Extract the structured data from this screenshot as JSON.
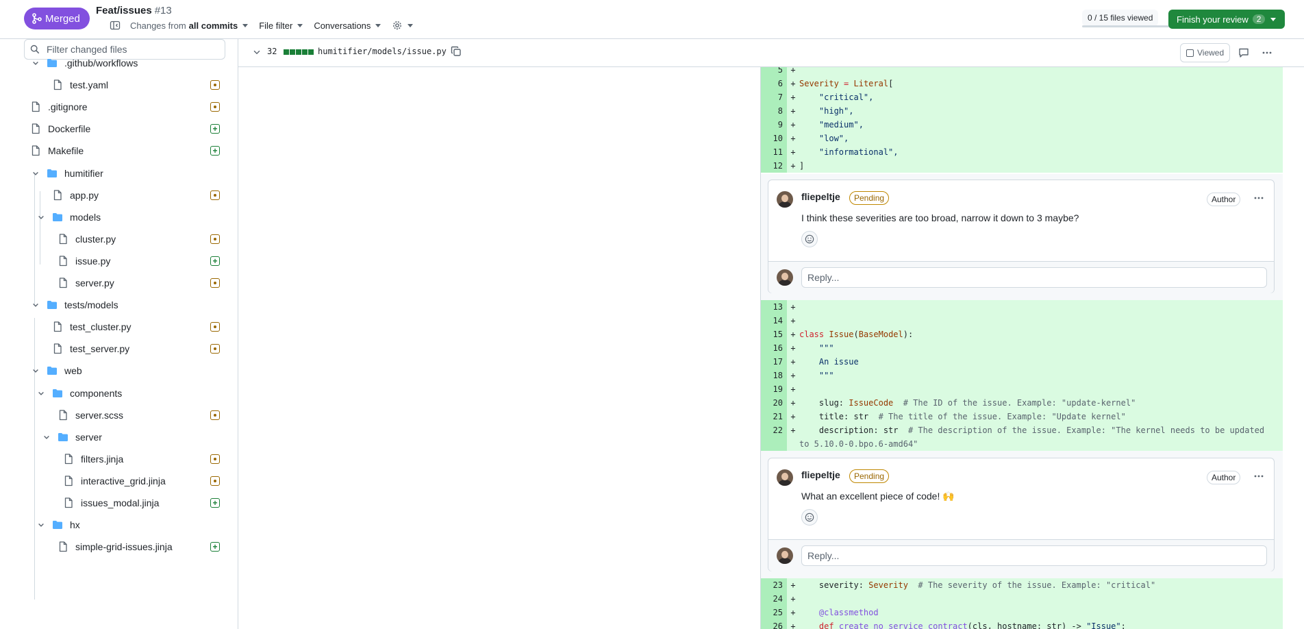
{
  "header": {
    "status_badge": "Merged",
    "pr_title": "Feat/issues",
    "pr_number": "#13",
    "changes_prefix": "Changes from",
    "changes_value": "all commits",
    "file_filter": "File filter",
    "conversations": "Conversations",
    "files_viewed": "0 / 15 files viewed",
    "finish_review": "Finish your review",
    "finish_count": "2"
  },
  "sidebar": {
    "filter_placeholder": "Filter changed files",
    "items": [
      {
        "label": ".github/workflows",
        "type": "folder"
      },
      {
        "label": "test.yaml",
        "type": "file",
        "status": "modified"
      },
      {
        "label": ".gitignore",
        "type": "file",
        "status": "modified"
      },
      {
        "label": "Dockerfile",
        "type": "file",
        "status": "added"
      },
      {
        "label": "Makefile",
        "type": "file",
        "status": "added"
      },
      {
        "label": "humitifier",
        "type": "folder"
      },
      {
        "label": "app.py",
        "type": "file",
        "status": "modified"
      },
      {
        "label": "models",
        "type": "folder"
      },
      {
        "label": "cluster.py",
        "type": "file",
        "status": "modified"
      },
      {
        "label": "issue.py",
        "type": "file",
        "status": "added"
      },
      {
        "label": "server.py",
        "type": "file",
        "status": "modified"
      },
      {
        "label": "tests/models",
        "type": "folder"
      },
      {
        "label": "test_cluster.py",
        "type": "file",
        "status": "modified"
      },
      {
        "label": "test_server.py",
        "type": "file",
        "status": "modified"
      },
      {
        "label": "web",
        "type": "folder"
      },
      {
        "label": "components",
        "type": "folder"
      },
      {
        "label": "server.scss",
        "type": "file",
        "status": "modified"
      },
      {
        "label": "server",
        "type": "folder"
      },
      {
        "label": "filters.jinja",
        "type": "file",
        "status": "modified"
      },
      {
        "label": "interactive_grid.jinja",
        "type": "file",
        "status": "modified"
      },
      {
        "label": "issues_modal.jinja",
        "type": "file",
        "status": "added"
      },
      {
        "label": "hx",
        "type": "folder"
      },
      {
        "label": "simple-grid-issues.jinja",
        "type": "file",
        "status": "added"
      }
    ]
  },
  "file": {
    "changes": "32",
    "path": "humitifier/models/issue.py",
    "viewed_label": "Viewed"
  },
  "diff": {
    "block1": [
      {
        "n": "5",
        "code": ""
      },
      {
        "n": "6",
        "code": "Severity = Literal["
      },
      {
        "n": "7",
        "code": "    \"critical\","
      },
      {
        "n": "8",
        "code": "    \"high\","
      },
      {
        "n": "9",
        "code": "    \"medium\","
      },
      {
        "n": "10",
        "code": "    \"low\","
      },
      {
        "n": "11",
        "code": "    \"informational\","
      },
      {
        "n": "12",
        "code": "]"
      }
    ],
    "block2": [
      {
        "n": "13",
        "code": ""
      },
      {
        "n": "14",
        "code": ""
      },
      {
        "n": "15",
        "code": "class Issue(BaseModel):"
      },
      {
        "n": "16",
        "code": "    \"\"\""
      },
      {
        "n": "17",
        "code": "    An issue"
      },
      {
        "n": "18",
        "code": "    \"\"\""
      },
      {
        "n": "19",
        "code": ""
      },
      {
        "n": "20",
        "code": "    slug: IssueCode  # The ID of the issue. Example: \"update-kernel\""
      },
      {
        "n": "21",
        "code": "    title: str  # The title of the issue. Example: \"Update kernel\""
      },
      {
        "n": "22",
        "code": "    description: str  # The description of the issue. Example: \"The kernel needs to be updated to 5.10.0-0.bpo.6-amd64\""
      }
    ],
    "block3": [
      {
        "n": "23",
        "code": "    severity: Severity  # The severity of the issue. Example: \"critical\""
      },
      {
        "n": "24",
        "code": ""
      },
      {
        "n": "25",
        "code": "    @classmethod"
      },
      {
        "n": "26",
        "code": "    def create_no_service_contract(cls, hostname: str) -> \"Issue\":"
      }
    ]
  },
  "comments": [
    {
      "author": "fliepeltje",
      "state": "Pending",
      "role": "Author",
      "body": "I think these severities are too broad, narrow it down to 3 maybe?",
      "reply_placeholder": "Reply..."
    },
    {
      "author": "fliepeltje",
      "state": "Pending",
      "role": "Author",
      "body": "What an excellent piece of code! 🙌",
      "reply_placeholder": "Reply..."
    }
  ],
  "colors": {
    "merged": "#8250df",
    "finish": "#1f883d",
    "added_bg": "#dafbe1",
    "added_num_bg": "#aceebb",
    "modified": "#9a6700",
    "added": "#1a7f37"
  }
}
